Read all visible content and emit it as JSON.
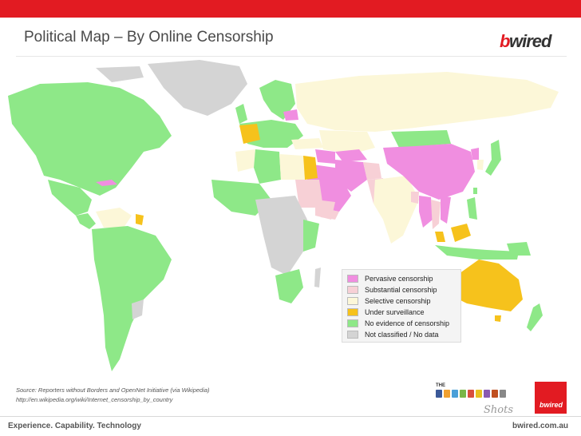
{
  "slide": {
    "title": "Political Map – By Online Censorship",
    "logo": {
      "b": "b",
      "rest": "wired"
    },
    "source_line1": "Source: Reporters without Borders and OpenNet Initiative (via Wikipedia)",
    "source_line2": "http://en.wikipedia.org/wiki/Internet_censorship_by_country",
    "footer_left": "Experience. Capability. Technology",
    "footer_right": "bwired.com.au",
    "corner_logo": "bwired",
    "badge_tag": "THE",
    "script_text": "Shots"
  },
  "colors": {
    "brand_red": "#e21b22",
    "pervasive": "#f08ee0",
    "substantial": "#f7d0d6",
    "selective": "#fcf7d8",
    "surveillance": "#f6c21c",
    "no_evidence": "#8ee888",
    "not_classified": "#d4d4d4"
  },
  "legend": [
    {
      "label": "Pervasive censorship",
      "color": "#f08ee0"
    },
    {
      "label": "Substantial censorship",
      "color": "#f7d0d6"
    },
    {
      "label": "Selective censorship",
      "color": "#fcf7d8"
    },
    {
      "label": "Under surveillance",
      "color": "#f6c21c"
    },
    {
      "label": "No evidence of censorship",
      "color": "#8ee888"
    },
    {
      "label": "Not classified / No data",
      "color": "#d4d4d4"
    }
  ]
}
